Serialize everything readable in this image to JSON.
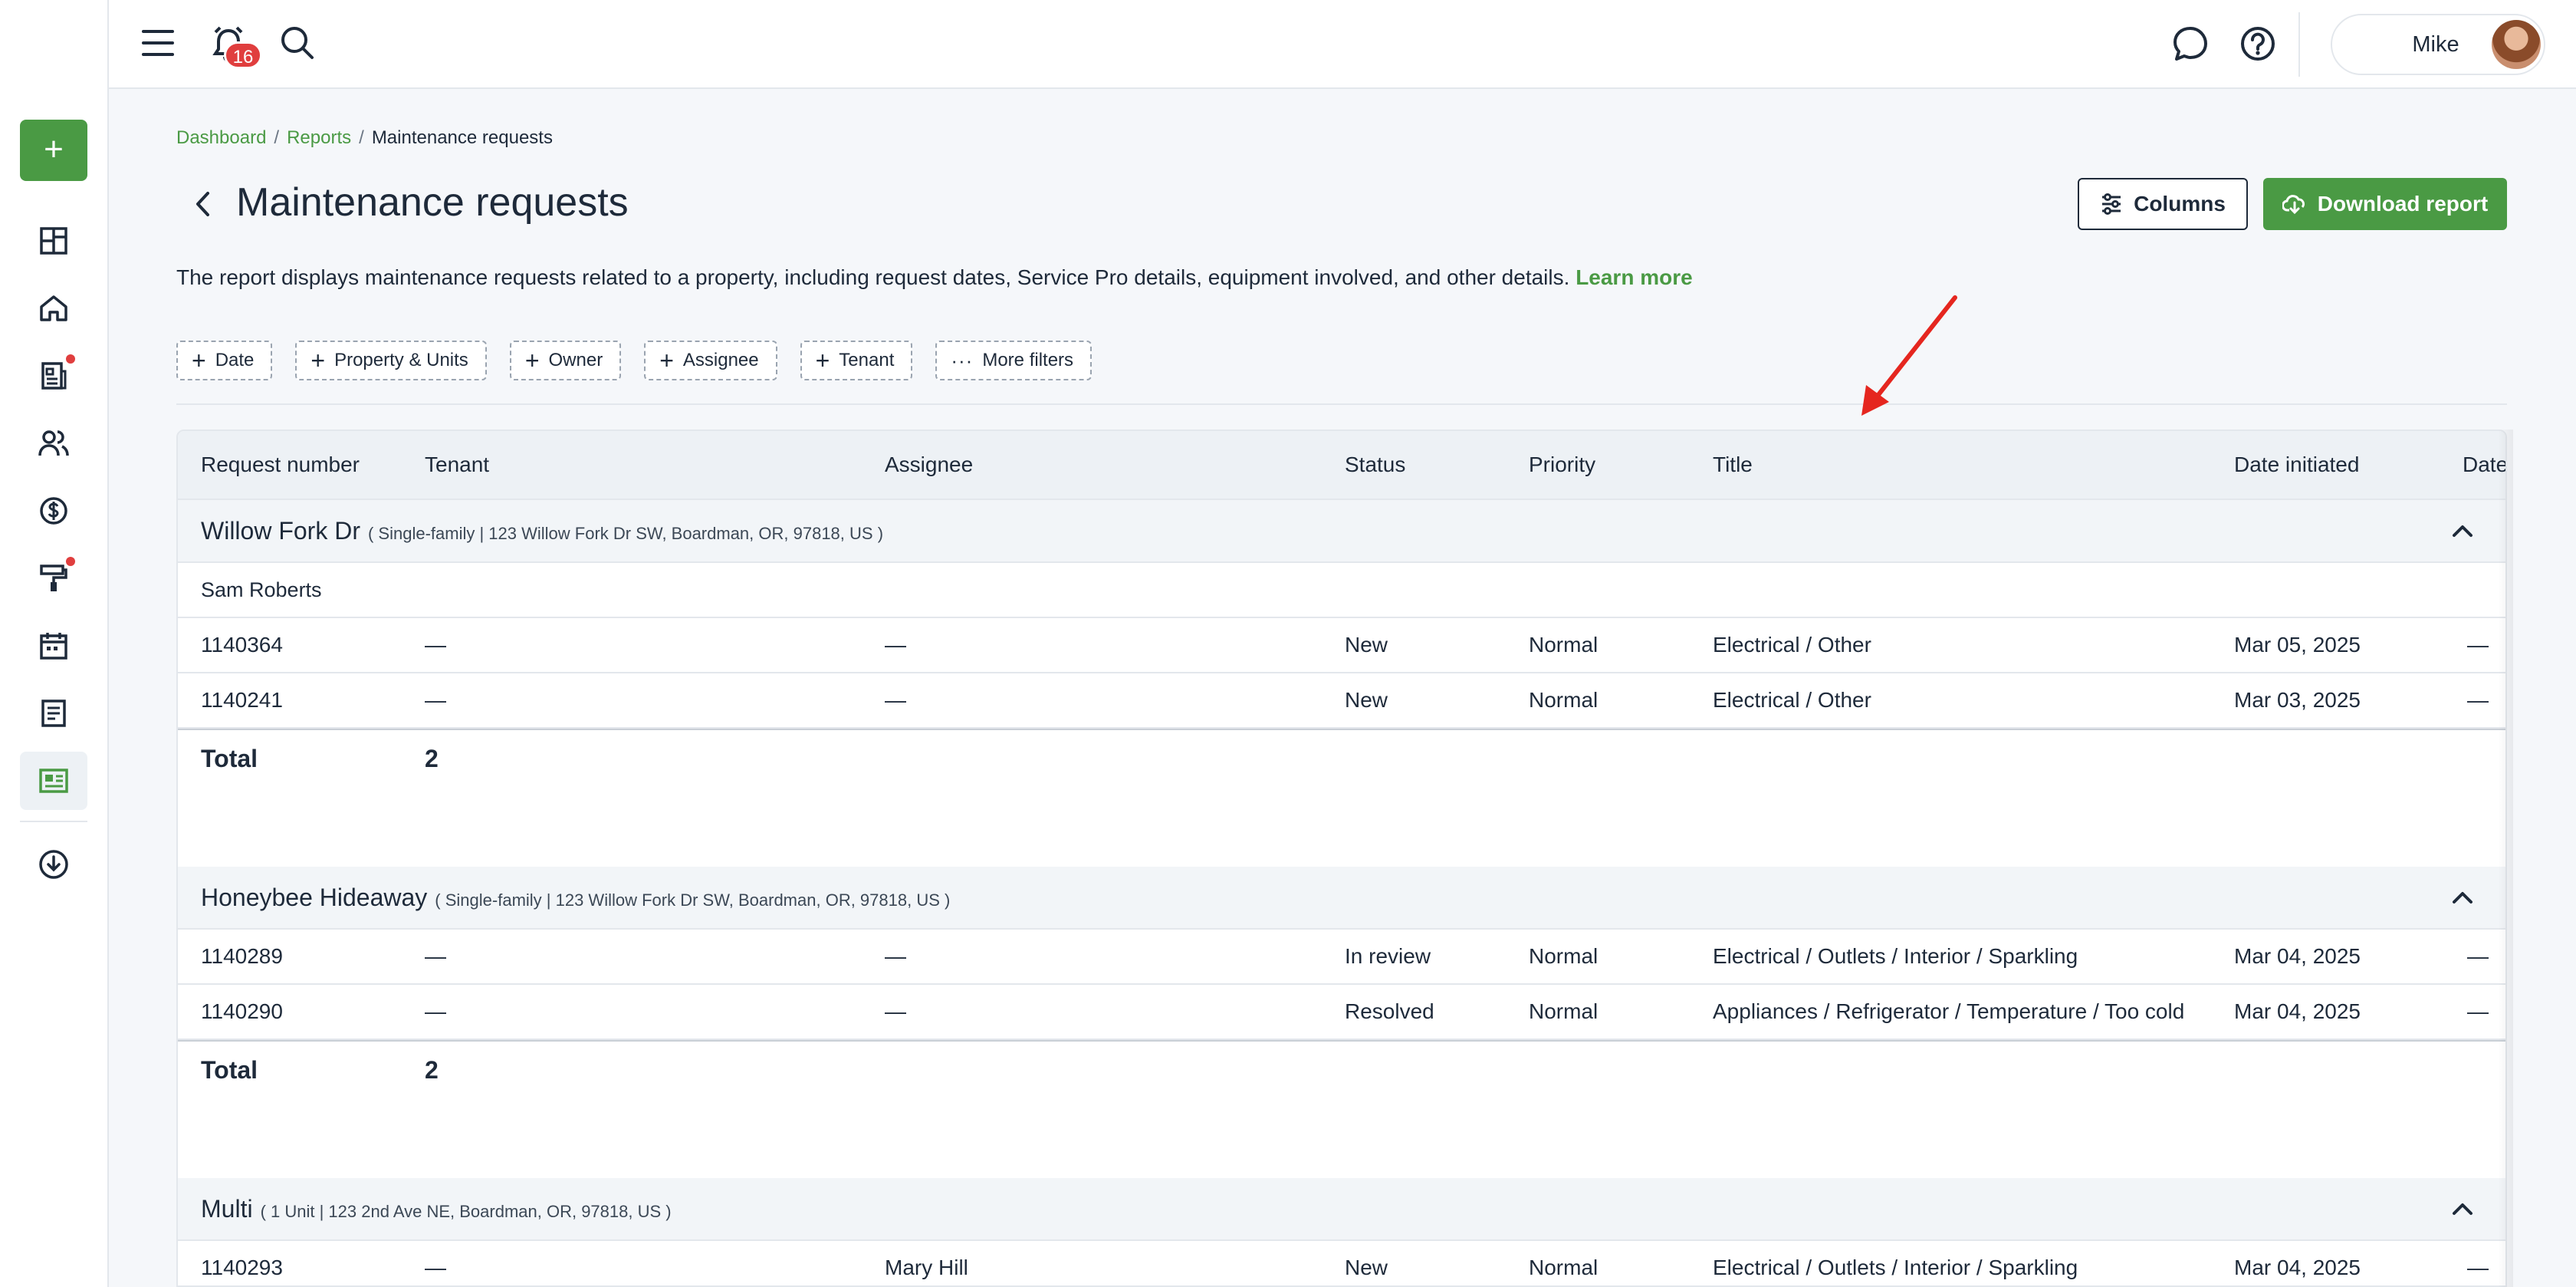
{
  "topbar": {
    "notification_count": "16",
    "user_name": "Mike",
    "menu_icon": "hamburger-menu-icon",
    "bell_icon": "alarm-bell-icon",
    "search_icon": "search-icon",
    "chat_icon": "chat-bubble-icon",
    "help_icon": "help-circle-icon"
  },
  "sidebar": {
    "add_label": "+",
    "items": [
      {
        "name": "dashboard",
        "icon": "grid-icon"
      },
      {
        "name": "properties",
        "icon": "home-icon"
      },
      {
        "name": "leases",
        "icon": "document-list-icon"
      },
      {
        "name": "people",
        "icon": "users-icon"
      },
      {
        "name": "accounting",
        "icon": "dollar-circle-icon"
      },
      {
        "name": "maintenance",
        "icon": "paint-roller-icon"
      },
      {
        "name": "calendar",
        "icon": "calendar-icon"
      },
      {
        "name": "notes",
        "icon": "notes-icon"
      },
      {
        "name": "reports",
        "icon": "report-card-icon"
      },
      {
        "name": "downloads",
        "icon": "cloud-download-icon"
      }
    ]
  },
  "breadcrumb": {
    "items": [
      "Dashboard",
      "Reports"
    ],
    "current": "Maintenance requests",
    "separator": "/"
  },
  "page": {
    "title": "Maintenance requests",
    "description": "The report displays maintenance requests related to a property, including request dates, Service Pro details, equipment involved, and other details.",
    "learn_more": "Learn more",
    "columns_label": "Columns",
    "download_label": "Download report"
  },
  "filters": [
    "Date",
    "Property & Units",
    "Owner",
    "Assignee",
    "Tenant",
    "More filters"
  ],
  "table": {
    "headers": [
      "Request number",
      "Tenant",
      "Assignee",
      "Status",
      "Priority",
      "Title",
      "Date initiated",
      "Date"
    ],
    "total_label": "Total",
    "groups": [
      {
        "name": "Willow Fork Dr",
        "meta": "( Single-family | 123 Willow Fork Dr SW, Boardman, OR, 97818, US )",
        "sub": "Sam Roberts",
        "rows": [
          [
            "1140364",
            "—",
            "—",
            "New",
            "Normal",
            "Electrical / Other",
            "Mar 05, 2025",
            "—"
          ],
          [
            "1140241",
            "—",
            "—",
            "New",
            "Normal",
            "Electrical / Other",
            "Mar 03, 2025",
            "—"
          ]
        ],
        "total": "2"
      },
      {
        "name": "Honeybee Hideaway",
        "meta": "( Single-family | 123 Willow Fork Dr SW, Boardman, OR, 97818, US )",
        "rows": [
          [
            "1140289",
            "—",
            "—",
            "In review",
            "Normal",
            "Electrical / Outlets / Interior / Sparkling",
            "Mar 04, 2025",
            "—"
          ],
          [
            "1140290",
            "—",
            "—",
            "Resolved",
            "Normal",
            "Appliances / Refrigerator / Temperature / Too cold",
            "Mar 04, 2025",
            "—"
          ]
        ],
        "total": "2"
      },
      {
        "name": "Multi",
        "meta": "( 1 Unit | 123 2nd Ave NE, Boardman, OR, 97818, US )",
        "rows": [
          [
            "1140293",
            "—",
            "Mary Hill",
            "New",
            "Normal",
            "Electrical / Outlets / Interior / Sparkling",
            "Mar 04, 2025",
            "—"
          ]
        ]
      }
    ]
  },
  "colors": {
    "brand_green": "#4a9a44",
    "alert_red": "#e03e3e",
    "annotation_arrow": "#e5261f"
  }
}
